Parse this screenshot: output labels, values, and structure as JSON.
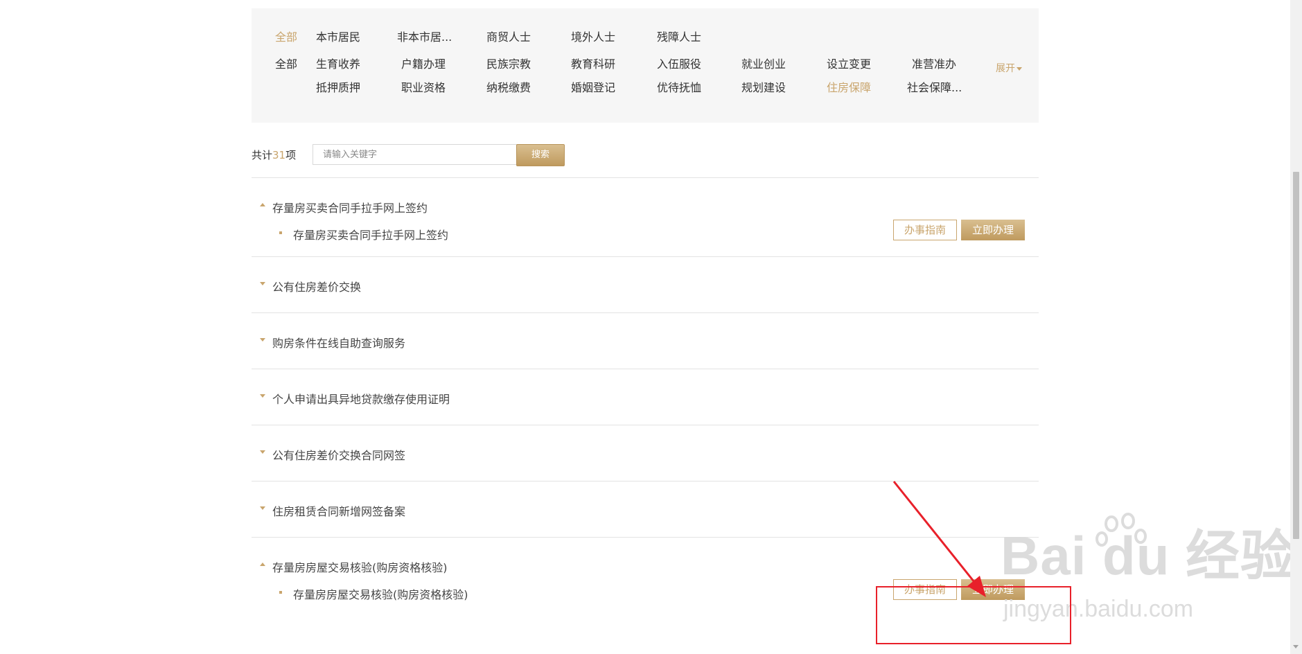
{
  "filters": {
    "audience_row": [
      "全部",
      "本市居民",
      "非本市居...",
      "商贸人士",
      "境外人士",
      "残障人士"
    ],
    "topic_row1": [
      "全部",
      "生育收养",
      "户籍办理",
      "民族宗教",
      "教育科研",
      "入伍服役",
      "就业创业",
      "设立变更",
      "准营准办"
    ],
    "topic_row2": [
      "抵押质押",
      "职业资格",
      "纳税缴费",
      "婚姻登记",
      "优待抚恤",
      "规划建设",
      "住房保障",
      "社会保障..."
    ],
    "expand_label": "展开"
  },
  "search": {
    "count_prefix": "共计",
    "count_value": "31",
    "count_suffix": "项",
    "placeholder": "请输入关键字",
    "button_label": "搜索"
  },
  "buttons": {
    "guide_label": "办事指南",
    "go_label": "立即办理"
  },
  "sections": [
    {
      "title": "存量房买卖合同手拉手网上签约",
      "expanded": true,
      "sub": "存量房买卖合同手拉手网上签约"
    },
    {
      "title": "公有住房差价交换",
      "expanded": false
    },
    {
      "title": "购房条件在线自助查询服务",
      "expanded": false
    },
    {
      "title": "个人申请出具异地贷款缴存使用证明",
      "expanded": false
    },
    {
      "title": "公有住房差价交换合同网签",
      "expanded": false
    },
    {
      "title": "住房租赁合同新增网签备案",
      "expanded": false
    },
    {
      "title": "存量房房屋交易核验(购房资格核验)",
      "expanded": true,
      "sub": "存量房房屋交易核验(购房资格核验)"
    }
  ],
  "watermark": {
    "logo_text": "Bai du 经验",
    "url_text": "jingyan.baidu.com"
  },
  "colors": {
    "accent": "#c9a56d",
    "annotation": "#e8202a"
  }
}
